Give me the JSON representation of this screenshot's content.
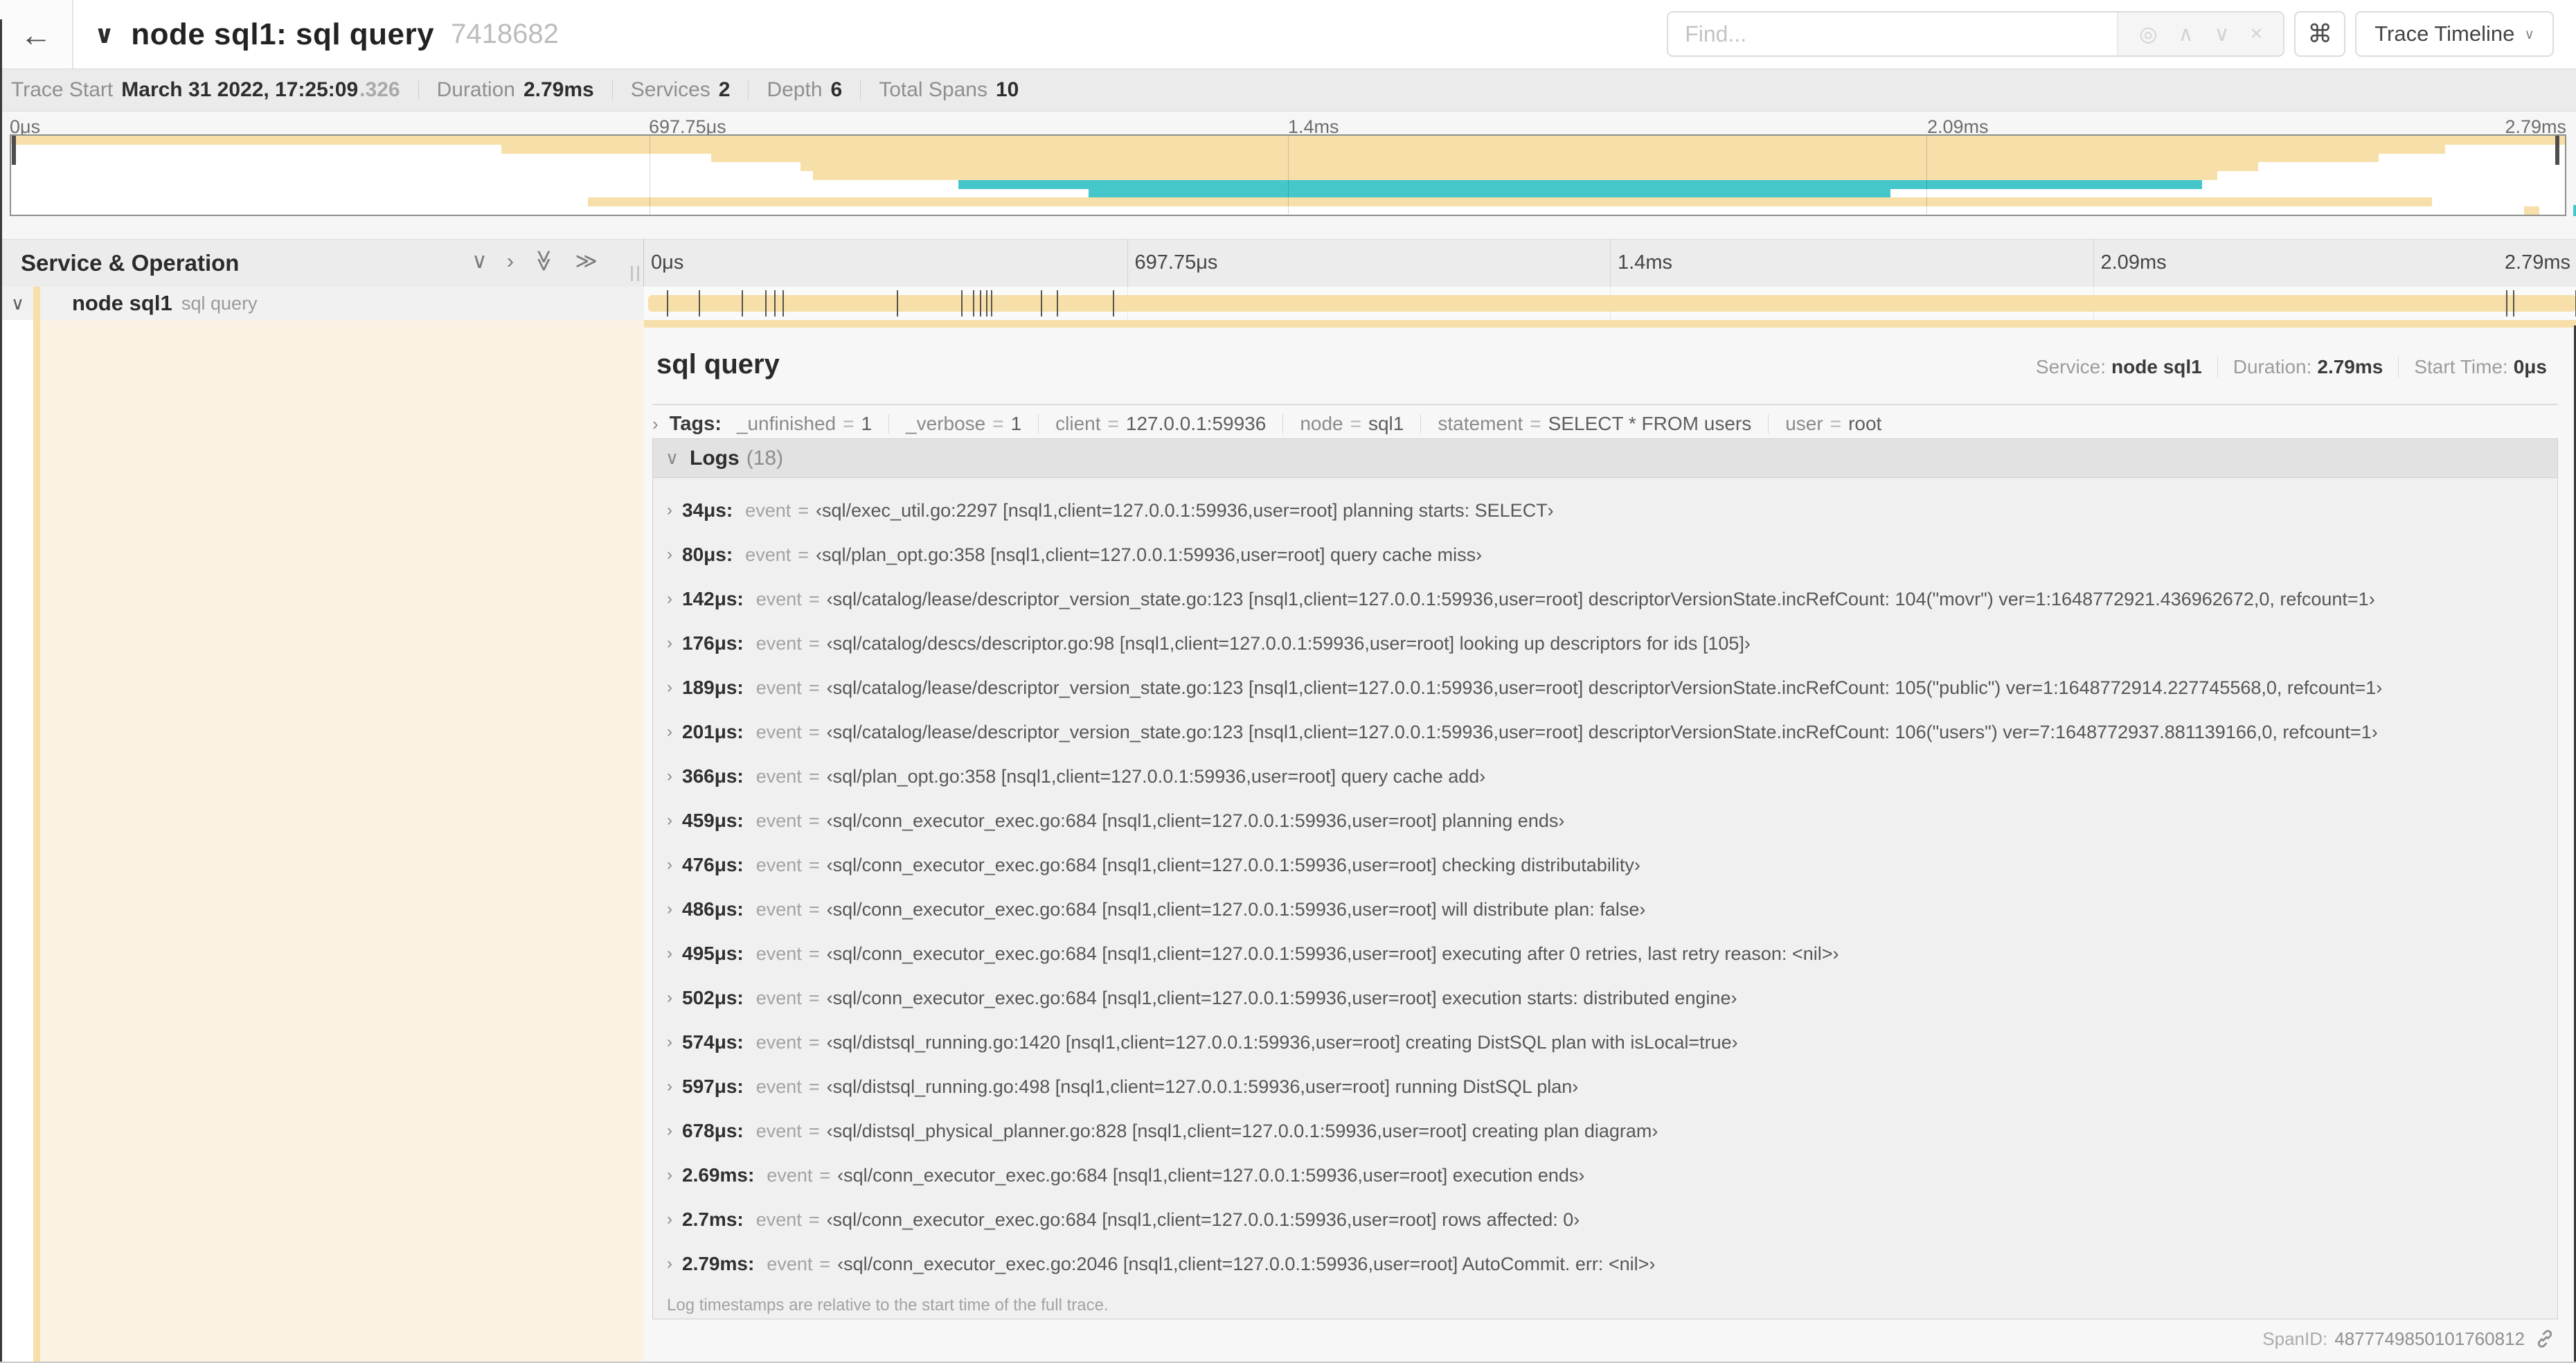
{
  "header": {
    "back_icon": "←",
    "collapse_icon": "∨",
    "title": "node sql1: sql query",
    "trace_id": "7418682",
    "find_placeholder": "Find...",
    "find_icons": [
      {
        "name": "locate-icon",
        "glyph": "◎"
      },
      {
        "name": "prev-result-icon",
        "glyph": "∧"
      },
      {
        "name": "next-result-icon",
        "glyph": "∨"
      },
      {
        "name": "clear-search-icon",
        "glyph": "×"
      }
    ],
    "shortcuts_button": "⌘",
    "view_selector": "Trace Timeline",
    "view_selector_chevron": "∨"
  },
  "meta": {
    "items": [
      {
        "label": "Trace Start",
        "value": "March 31 2022, 17:25:09",
        "suffix": ".326"
      },
      {
        "label": "Duration",
        "value": "2.79ms"
      },
      {
        "label": "Services",
        "value": "2"
      },
      {
        "label": "Depth",
        "value": "6"
      },
      {
        "label": "Total Spans",
        "value": "10"
      }
    ]
  },
  "timeline": {
    "axis_ticks": [
      "0μs",
      "697.75μs",
      "1.4ms",
      "2.09ms",
      "2.79ms"
    ],
    "column_header": "Service & Operation",
    "controls": [
      {
        "name": "collapse-one-icon",
        "glyph": "∨",
        "rotate": false
      },
      {
        "name": "expand-one-icon",
        "glyph": "›",
        "rotate": false
      },
      {
        "name": "collapse-all-icon",
        "glyph": "≫",
        "rotate": true
      },
      {
        "name": "expand-all-icon",
        "glyph": "≫",
        "rotate": false
      }
    ],
    "total_duration_us": 2790
  },
  "minimap": {
    "bars": [
      {
        "start": 0.0,
        "end": 100.0,
        "color": "tan"
      },
      {
        "start": 19.2,
        "end": 95.3,
        "color": "tan"
      },
      {
        "start": 27.4,
        "end": 92.7,
        "color": "tan"
      },
      {
        "start": 30.9,
        "end": 88.0,
        "color": "tan"
      },
      {
        "start": 31.4,
        "end": 86.4,
        "color": "tan"
      },
      {
        "start": 37.1,
        "end": 85.8,
        "color": "teal"
      },
      {
        "start": 42.2,
        "end": 73.6,
        "color": "teal"
      },
      {
        "start": 22.6,
        "end": 94.8,
        "color": "tan"
      },
      {
        "start": 98.4,
        "end": 99.0,
        "color": "tan"
      }
    ]
  },
  "span_row": {
    "chevron": "∨",
    "service": "node sql1",
    "operation": "sql query",
    "bar": {
      "start_pct": 0.2,
      "end_pct": 100
    }
  },
  "detail": {
    "title": "sql query",
    "meta": [
      {
        "label": "Service:",
        "value": "node sql1"
      },
      {
        "label": "Duration:",
        "value": "2.79ms"
      },
      {
        "label": "Start Time:",
        "value": "0μs"
      }
    ],
    "expand_icon": "›",
    "collapse_icon": "∨",
    "eq": "=",
    "tags_label": "Tags:",
    "tags": [
      {
        "key": "_unfinished",
        "value": "1"
      },
      {
        "key": "_verbose",
        "value": "1"
      },
      {
        "key": "client",
        "value": "127.0.0.1:59936"
      },
      {
        "key": "node",
        "value": "sql1"
      },
      {
        "key": "statement",
        "value": "SELECT * FROM users"
      },
      {
        "key": "user",
        "value": "root"
      }
    ],
    "logs_label": "Logs",
    "logs_count": "(18)",
    "logs": [
      {
        "time": "34μs:",
        "t_us": 34,
        "key": "event",
        "value": "‹sql/exec_util.go:2297 [nsql1,client=127.0.0.1:59936,user=root] planning starts: SELECT›"
      },
      {
        "time": "80μs:",
        "t_us": 80,
        "key": "event",
        "value": "‹sql/plan_opt.go:358 [nsql1,client=127.0.0.1:59936,user=root] query cache miss›"
      },
      {
        "time": "142μs:",
        "t_us": 142,
        "key": "event",
        "value": "‹sql/catalog/lease/descriptor_version_state.go:123 [nsql1,client=127.0.0.1:59936,user=root] descriptorVersionState.incRefCount: 104(\"movr\") ver=1:1648772921.436962672,0, refcount=1›"
      },
      {
        "time": "176μs:",
        "t_us": 176,
        "key": "event",
        "value": "‹sql/catalog/descs/descriptor.go:98 [nsql1,client=127.0.0.1:59936,user=root] looking up descriptors for ids [105]›"
      },
      {
        "time": "189μs:",
        "t_us": 189,
        "key": "event",
        "value": "‹sql/catalog/lease/descriptor_version_state.go:123 [nsql1,client=127.0.0.1:59936,user=root] descriptorVersionState.incRefCount: 105(\"public\") ver=1:1648772914.227745568,0, refcount=1›"
      },
      {
        "time": "201μs:",
        "t_us": 201,
        "key": "event",
        "value": "‹sql/catalog/lease/descriptor_version_state.go:123 [nsql1,client=127.0.0.1:59936,user=root] descriptorVersionState.incRefCount: 106(\"users\") ver=7:1648772937.881139166,0, refcount=1›"
      },
      {
        "time": "366μs:",
        "t_us": 366,
        "key": "event",
        "value": "‹sql/plan_opt.go:358 [nsql1,client=127.0.0.1:59936,user=root] query cache add›"
      },
      {
        "time": "459μs:",
        "t_us": 459,
        "key": "event",
        "value": "‹sql/conn_executor_exec.go:684 [nsql1,client=127.0.0.1:59936,user=root] planning ends›"
      },
      {
        "time": "476μs:",
        "t_us": 476,
        "key": "event",
        "value": "‹sql/conn_executor_exec.go:684 [nsql1,client=127.0.0.1:59936,user=root] checking distributability›"
      },
      {
        "time": "486μs:",
        "t_us": 486,
        "key": "event",
        "value": "‹sql/conn_executor_exec.go:684 [nsql1,client=127.0.0.1:59936,user=root] will distribute plan: false›"
      },
      {
        "time": "495μs:",
        "t_us": 495,
        "key": "event",
        "value": "‹sql/conn_executor_exec.go:684 [nsql1,client=127.0.0.1:59936,user=root] executing after 0 retries, last retry reason: <nil>›"
      },
      {
        "time": "502μs:",
        "t_us": 502,
        "key": "event",
        "value": "‹sql/conn_executor_exec.go:684 [nsql1,client=127.0.0.1:59936,user=root] execution starts: distributed engine›"
      },
      {
        "time": "574μs:",
        "t_us": 574,
        "key": "event",
        "value": "‹sql/distsql_running.go:1420 [nsql1,client=127.0.0.1:59936,user=root] creating DistSQL plan with isLocal=true›"
      },
      {
        "time": "597μs:",
        "t_us": 597,
        "key": "event",
        "value": "‹sql/distsql_running.go:498 [nsql1,client=127.0.0.1:59936,user=root] running DistSQL plan›"
      },
      {
        "time": "678μs:",
        "t_us": 678,
        "key": "event",
        "value": "‹sql/distsql_physical_planner.go:828 [nsql1,client=127.0.0.1:59936,user=root] creating plan diagram›"
      },
      {
        "time": "2.69ms:",
        "t_us": 2690,
        "key": "event",
        "value": "‹sql/conn_executor_exec.go:684 [nsql1,client=127.0.0.1:59936,user=root] execution ends›"
      },
      {
        "time": "2.7ms:",
        "t_us": 2700,
        "key": "event",
        "value": "‹sql/conn_executor_exec.go:684 [nsql1,client=127.0.0.1:59936,user=root] rows affected: 0›"
      },
      {
        "time": "2.79ms:",
        "t_us": 2790,
        "key": "event",
        "value": "‹sql/conn_executor_exec.go:2046 [nsql1,client=127.0.0.1:59936,user=root] AutoCommit. err: <nil>›"
      }
    ],
    "logs_footer": "Log timestamps are relative to the start time of the full trace.",
    "span_id_label": "SpanID:",
    "span_id": "4877749850101760812"
  },
  "colors": {
    "tan": "#F7DFA9",
    "teal": "#45C6CB",
    "cream": "#FAF3E4"
  }
}
